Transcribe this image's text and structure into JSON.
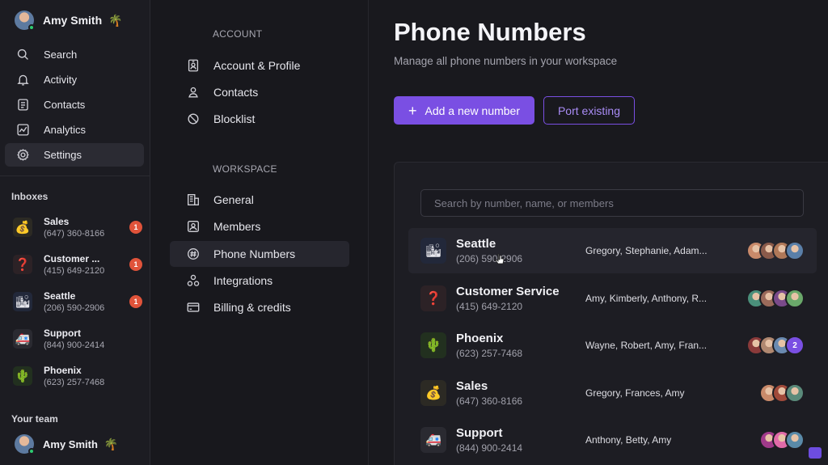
{
  "user": {
    "name": "Amy Smith",
    "emoji": "🌴"
  },
  "nav": [
    {
      "label": "Search",
      "icon": "search-icon",
      "active": false
    },
    {
      "label": "Activity",
      "icon": "bell-icon",
      "active": false
    },
    {
      "label": "Contacts",
      "icon": "contacts-icon",
      "active": false
    },
    {
      "label": "Analytics",
      "icon": "analytics-icon",
      "active": false
    },
    {
      "label": "Settings",
      "icon": "gear-icon",
      "active": true
    }
  ],
  "inboxes_heading": "Inboxes",
  "inboxes": [
    {
      "name": "Sales",
      "number": "(647) 360-8166",
      "emoji": "💰",
      "badge": "1"
    },
    {
      "name": "Customer ...",
      "number": "(415) 649-2120",
      "emoji": "❓",
      "badge": "1"
    },
    {
      "name": "Seattle",
      "number": "(206) 590-2906",
      "emoji": "🏙",
      "badge": "1"
    },
    {
      "name": "Support",
      "number": "(844) 900-2414",
      "emoji": "🚑",
      "badge": ""
    },
    {
      "name": "Phoenix",
      "number": "(623) 257-7468",
      "emoji": "🌵",
      "badge": ""
    }
  ],
  "team_heading": "Your team",
  "team": [
    {
      "name": "Amy Smith",
      "emoji": "🌴"
    }
  ],
  "settings": {
    "account_heading": "ACCOUNT",
    "account_items": [
      {
        "label": "Account & Profile",
        "icon": "id-badge-icon"
      },
      {
        "label": "Contacts",
        "icon": "person-icon"
      },
      {
        "label": "Blocklist",
        "icon": "block-icon"
      }
    ],
    "workspace_heading": "WORKSPACE",
    "workspace_items": [
      {
        "label": "General",
        "icon": "building-icon",
        "active": false
      },
      {
        "label": "Members",
        "icon": "members-icon",
        "active": false
      },
      {
        "label": "Phone Numbers",
        "icon": "hash-icon",
        "active": true
      },
      {
        "label": "Integrations",
        "icon": "integrations-icon",
        "active": false
      },
      {
        "label": "Billing & credits",
        "icon": "card-icon",
        "active": false
      }
    ]
  },
  "main": {
    "title": "Phone Numbers",
    "subtitle": "Manage all phone numbers in your workspace",
    "add_button": "Add a new number",
    "port_button": "Port existing",
    "search_placeholder": "Search by number, name, or members"
  },
  "numbers": [
    {
      "name": "Seattle",
      "number": "(206) 590-2906",
      "emoji": "🏙",
      "members": "Gregory, Stephanie, Adam...",
      "avatars": [
        "#c98a6a",
        "#8a5a4a",
        "#b07858",
        "#5a7fa8"
      ],
      "extra": ""
    },
    {
      "name": "Customer Service",
      "number": "(415) 649-2120",
      "emoji": "❓",
      "members": "Amy, Kimberly, Anthony, R...",
      "avatars": [
        "#4a8f7a",
        "#9a6a5a",
        "#7a4a8a",
        "#6aa86a"
      ],
      "extra": ""
    },
    {
      "name": "Phoenix",
      "number": "(623) 257-7468",
      "emoji": "🌵",
      "members": "Wayne, Robert, Amy, Fran...",
      "avatars": [
        "#8a3a3a",
        "#b08870",
        "#6a8ab0"
      ],
      "extra": "2"
    },
    {
      "name": "Sales",
      "number": "(647) 360-8166",
      "emoji": "💰",
      "members": "Gregory, Frances, Amy",
      "avatars": [
        "#c98a6a",
        "#a04a3a",
        "#5a8a7a"
      ],
      "extra": ""
    },
    {
      "name": "Support",
      "number": "(844) 900-2414",
      "emoji": "🚑",
      "members": "Anthony, Betty, Amy",
      "avatars": [
        "#a03a8a",
        "#e06aa8",
        "#5a8aa8"
      ],
      "extra": ""
    }
  ],
  "colors": {
    "accent": "#7a4fe3",
    "badge": "#e0533a",
    "online": "#2ecc71"
  }
}
